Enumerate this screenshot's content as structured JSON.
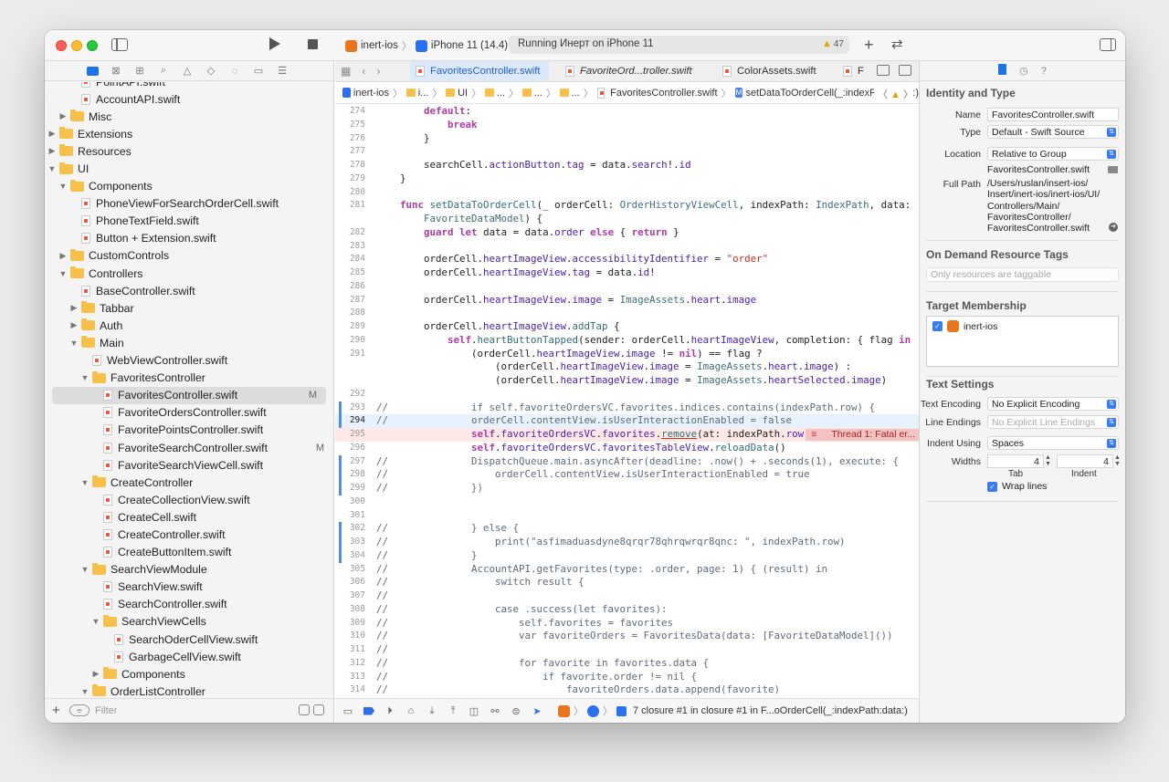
{
  "toolbar": {
    "scheme": "inert-ios",
    "device": "iPhone 11 (14.4)",
    "activity": "Running Инерт on iPhone 11",
    "warning_count": "47"
  },
  "navigator": {
    "tree": [
      {
        "label": "PointAPI.swift",
        "kind": "file",
        "indent": 4,
        "disclosure": ""
      },
      {
        "label": "AccountAPI.swift",
        "kind": "file",
        "indent": 4,
        "disclosure": ""
      },
      {
        "label": "Misc",
        "kind": "folder",
        "indent": 3,
        "disclosure": "▶"
      },
      {
        "label": "Extensions",
        "kind": "folder",
        "indent": 2,
        "disclosure": "▶"
      },
      {
        "label": "Resources",
        "kind": "folder",
        "indent": 2,
        "disclosure": "▶"
      },
      {
        "label": "UI",
        "kind": "folder",
        "indent": 2,
        "disclosure": "▼"
      },
      {
        "label": "Components",
        "kind": "folder",
        "indent": 3,
        "disclosure": "▼"
      },
      {
        "label": "PhoneViewForSearchOrderCell.swift",
        "kind": "file",
        "indent": 4,
        "disclosure": ""
      },
      {
        "label": "PhoneTextField.swift",
        "kind": "file",
        "indent": 4,
        "disclosure": ""
      },
      {
        "label": "Button + Extension.swift",
        "kind": "file",
        "indent": 4,
        "disclosure": ""
      },
      {
        "label": "CustomControls",
        "kind": "folder",
        "indent": 3,
        "disclosure": "▶"
      },
      {
        "label": "Controllers",
        "kind": "folder",
        "indent": 3,
        "disclosure": "▼"
      },
      {
        "label": "BaseController.swift",
        "kind": "file",
        "indent": 4,
        "disclosure": ""
      },
      {
        "label": "Tabbar",
        "kind": "folder",
        "indent": 4,
        "disclosure": "▶"
      },
      {
        "label": "Auth",
        "kind": "folder",
        "indent": 4,
        "disclosure": "▶"
      },
      {
        "label": "Main",
        "kind": "folder",
        "indent": 4,
        "disclosure": "▼"
      },
      {
        "label": "WebViewController.swift",
        "kind": "file",
        "indent": 5,
        "disclosure": ""
      },
      {
        "label": "FavoritesController",
        "kind": "folder",
        "indent": 5,
        "disclosure": "▼"
      },
      {
        "label": "FavoritesController.swift",
        "kind": "file",
        "indent": 6,
        "disclosure": "",
        "badge": "M",
        "selected": true
      },
      {
        "label": "FavoriteOrdersController.swift",
        "kind": "file",
        "indent": 6,
        "disclosure": ""
      },
      {
        "label": "FavoritePointsController.swift",
        "kind": "file",
        "indent": 6,
        "disclosure": ""
      },
      {
        "label": "FavoriteSearchController.swift",
        "kind": "file",
        "indent": 6,
        "disclosure": "",
        "badge": "M"
      },
      {
        "label": "FavoriteSearchViewCell.swift",
        "kind": "file",
        "indent": 6,
        "disclosure": ""
      },
      {
        "label": "CreateController",
        "kind": "folder",
        "indent": 5,
        "disclosure": "▼"
      },
      {
        "label": "CreateCollectionView.swift",
        "kind": "file",
        "indent": 6,
        "disclosure": ""
      },
      {
        "label": "CreateCell.swift",
        "kind": "file",
        "indent": 6,
        "disclosure": ""
      },
      {
        "label": "CreateController.swift",
        "kind": "file",
        "indent": 6,
        "disclosure": ""
      },
      {
        "label": "CreateButtonItem.swift",
        "kind": "file",
        "indent": 6,
        "disclosure": ""
      },
      {
        "label": "SearchViewModule",
        "kind": "folder",
        "indent": 5,
        "disclosure": "▼"
      },
      {
        "label": "SearchView.swift",
        "kind": "file",
        "indent": 6,
        "disclosure": ""
      },
      {
        "label": "SearchController.swift",
        "kind": "file",
        "indent": 6,
        "disclosure": ""
      },
      {
        "label": "SearchViewCells",
        "kind": "folder",
        "indent": 6,
        "disclosure": "▼"
      },
      {
        "label": "SearchOderCellView.swift",
        "kind": "file",
        "indent": 7,
        "disclosure": ""
      },
      {
        "label": "GarbageCellView.swift",
        "kind": "file",
        "indent": 7,
        "disclosure": ""
      },
      {
        "label": "Components",
        "kind": "folder",
        "indent": 6,
        "disclosure": "▶"
      },
      {
        "label": "OrderListController",
        "kind": "folder",
        "indent": 5,
        "disclosure": "▼"
      }
    ],
    "filter_placeholder": "Filter"
  },
  "editor": {
    "tabs": [
      {
        "label": "FavoritesController.swift",
        "active": true,
        "italic": false
      },
      {
        "label": "FavoriteOrd...troller.swift",
        "active": false,
        "italic": true
      },
      {
        "label": "ColorAssets.swift",
        "active": false,
        "italic": false
      },
      {
        "label": "F",
        "active": false,
        "italic": false
      }
    ],
    "jump_bar": {
      "project": "inert-ios",
      "group1": "i...",
      "group2": "UI",
      "group3": "...",
      "group4": "...",
      "group5": "...",
      "file": "FavoritesController.swift",
      "method": "setDataToOrderCell(_:indexPath:data:)"
    },
    "code_lines": [
      {
        "n": "274",
        "html": "        <span class=\"kw\">default</span>:"
      },
      {
        "n": "275",
        "html": "            <span class=\"kw\">break</span>"
      },
      {
        "n": "276",
        "html": "        }"
      },
      {
        "n": "277",
        "html": ""
      },
      {
        "n": "278",
        "html": "        searchCell.<span class=\"pr\">actionButton</span>.<span class=\"pr\">tag</span> = data.<span class=\"pr\">search</span>!.<span class=\"pr\">id</span>"
      },
      {
        "n": "279",
        "html": "    }"
      },
      {
        "n": "280",
        "html": ""
      },
      {
        "n": "281",
        "html": "    <span class=\"kw\">func</span> <span class=\"fn\">setDataToOrderCell</span>(_ orderCell: <span class=\"tp\">OrderHistoryViewCell</span>, indexPath: <span class=\"tp\">IndexPath</span>, data:\n        <span class=\"tp\">FavoriteDataModel</span>) {",
        "tall": true
      },
      {
        "n": "282",
        "html": "        <span class=\"kw\">guard</span> <span class=\"kw\">let</span> data = data.<span class=\"pr\">order</span> <span class=\"kw\">else</span> { <span class=\"kw\">return</span> }"
      },
      {
        "n": "283",
        "html": ""
      },
      {
        "n": "284",
        "html": "        orderCell.<span class=\"pr\">heartImageView</span>.<span class=\"pr\">accessibilityIdentifier</span> = <span class=\"st\">\"order\"</span>"
      },
      {
        "n": "285",
        "html": "        orderCell.<span class=\"pr\">heartImageView</span>.<span class=\"pr\">tag</span> = data.<span class=\"pr\">id</span>!"
      },
      {
        "n": "286",
        "html": ""
      },
      {
        "n": "287",
        "html": "        orderCell.<span class=\"pr\">heartImageView</span>.<span class=\"pr\">image</span> = <span class=\"tp\">ImageAssets</span>.<span class=\"pr\">heart</span>.<span class=\"pr\">image</span>"
      },
      {
        "n": "288",
        "html": ""
      },
      {
        "n": "289",
        "html": "        orderCell.<span class=\"pr\">heartImageView</span>.<span class=\"fn\">addTap</span> {"
      },
      {
        "n": "290",
        "html": "            <span class=\"kw\">self</span>.<span class=\"fn\">heartButtonTapped</span>(sender: orderCell.<span class=\"pr\">heartImageView</span>, completion: { flag <span class=\"kw\">in</span>"
      },
      {
        "n": "291",
        "html": "                (orderCell.<span class=\"pr\">heartImageView</span>.<span class=\"pr\">image</span> != <span class=\"kw\">nil</span>) == flag ?\n                    (orderCell.<span class=\"pr\">heartImageView</span>.<span class=\"pr\">image</span> = <span class=\"tp\">ImageAssets</span>.<span class=\"pr\">heart</span>.<span class=\"pr\">image</span>) :\n                    (orderCell.<span class=\"pr\">heartImageView</span>.<span class=\"pr\">image</span> = <span class=\"tp\">ImageAssets</span>.<span class=\"pr\">heartSelected</span>.<span class=\"pr\">image</span>)",
        "triple": true
      },
      {
        "n": "292",
        "html": ""
      },
      {
        "n": "293",
        "html": "<span class=\"cm\">//              if self.favoriteOrdersVC.favorites.indices.contains(indexPath.row) {</span>",
        "change": true
      },
      {
        "n": "294",
        "html": "<span class=\"cm\">//              orderCell.contentView.isUserInteractionEnabled = false</span>",
        "change": true,
        "current": true
      },
      {
        "n": "295",
        "html": "                <span class=\"kw\">self</span>.<span class=\"pr\">favoriteOrdersVC</span>.<span class=\"pr\">favorites</span>.<span class=\"fn\" style=\"text-decoration: underline; text-decoration-color:#d12f1b;\">remove</span>(at: indexPath.<span class=\"pr\">row</span>)",
        "error": true
      },
      {
        "n": "296",
        "html": "                <span class=\"kw\">self</span>.<span class=\"pr\">favoriteOrdersVC</span>.<span class=\"pr\">favoritesTableView</span>.<span class=\"fn\">reloadData</span>()"
      },
      {
        "n": "297",
        "html": "<span class=\"cm\">//              DispatchQueue.main.asyncAfter(deadline: .now() + .seconds(1), execute: {</span>",
        "change": true
      },
      {
        "n": "298",
        "html": "<span class=\"cm\">//                  orderCell.contentView.isUserInteractionEnabled = true</span>",
        "change": true
      },
      {
        "n": "299",
        "html": "<span class=\"cm\">//              })</span>",
        "change": true
      },
      {
        "n": "300",
        "html": ""
      },
      {
        "n": "301",
        "html": ""
      },
      {
        "n": "302",
        "html": "<span class=\"cm\">//              } else {</span>",
        "change": true
      },
      {
        "n": "303",
        "html": "<span class=\"cm\">//                  print(\"asfimaduasdyne8qrqr78qhrqwrqr8qnc: \", indexPath.row)</span>",
        "change": true
      },
      {
        "n": "304",
        "html": "<span class=\"cm\">//              }</span>",
        "change": true
      },
      {
        "n": "305",
        "html": "<span class=\"cm\">//              AccountAPI.getFavorites(type: .order, page: 1) { (result) in</span>"
      },
      {
        "n": "306",
        "html": "<span class=\"cm\">//                  switch result {</span>"
      },
      {
        "n": "307",
        "html": "<span class=\"cm\">//</span>"
      },
      {
        "n": "308",
        "html": "<span class=\"cm\">//                  case .success(let favorites):</span>"
      },
      {
        "n": "309",
        "html": "<span class=\"cm\">//                      self.favorites = favorites</span>"
      },
      {
        "n": "310",
        "html": "<span class=\"cm\">//                      var favoriteOrders = FavoritesData(data: [FavoriteDataModel]())</span>"
      },
      {
        "n": "311",
        "html": "<span class=\"cm\">//</span>"
      },
      {
        "n": "312",
        "html": "<span class=\"cm\">//                      for favorite in favorites.data {</span>"
      },
      {
        "n": "313",
        "html": "<span class=\"cm\">//                          if favorite.order != nil {</span>"
      },
      {
        "n": "314",
        "html": "<span class=\"cm\">//                              favoriteOrders.data.append(favorite)</span>"
      }
    ],
    "error_text": "Thread 1: Fatal er...",
    "debug_breadcrumb": "7 closure #1 in closure #1 in F...oOrderCell(_:indexPath:data:)"
  },
  "inspector": {
    "identity_title": "Identity and Type",
    "name_label": "Name",
    "name_value": "FavoritesController.swift",
    "type_label": "Type",
    "type_value": "Default - Swift Source",
    "location_label": "Location",
    "location_value": "Relative to Group",
    "location_file": "FavoritesController.swift",
    "fullpath_label": "Full Path",
    "fullpath_lines": [
      "/Users/ruslan/insert-ios/",
      "Insert/inert-ios/inert-ios/UI/",
      "Controllers/Main/",
      "FavoritesController/",
      "FavoritesController.swift"
    ],
    "tags_title": "On Demand Resource Tags",
    "tags_placeholder": "Only resources are taggable",
    "target_title": "Target Membership",
    "target_name": "inert-ios",
    "text_title": "Text Settings",
    "encoding_label": "Text Encoding",
    "encoding_value": "No Explicit Encoding",
    "endings_label": "Line Endings",
    "endings_value": "No Explicit Line Endings",
    "indent_label": "Indent Using",
    "indent_value": "Spaces",
    "widths_label": "Widths",
    "tab_width": "4",
    "indent_width": "4",
    "tab_label": "Tab",
    "indent_sub_label": "Indent",
    "wrap_label": "Wrap lines"
  }
}
